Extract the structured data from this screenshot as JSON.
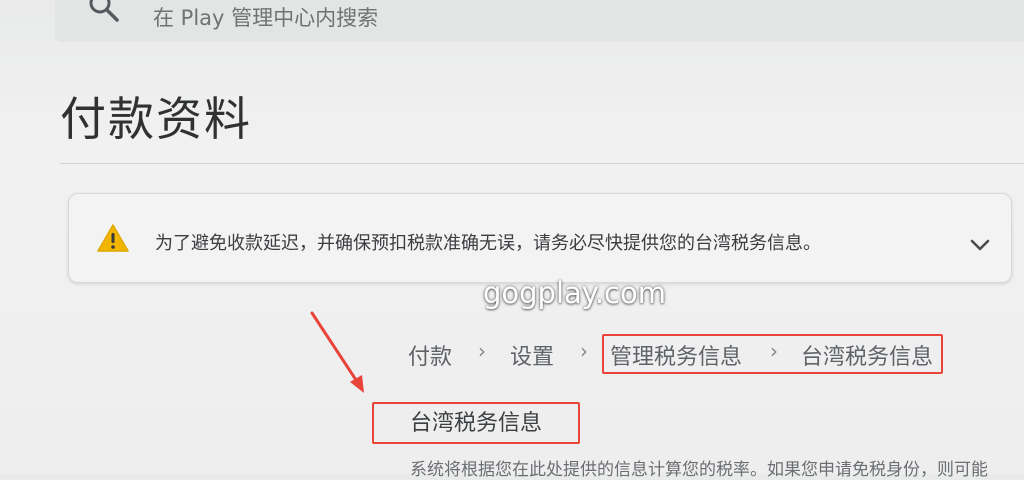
{
  "search": {
    "placeholder": "在 Play 管理中心内搜索"
  },
  "page": {
    "title": "付款资料"
  },
  "warning_banner": {
    "message": "为了避免收款延迟，并确保预扣税款准确无误，请务必尽快提供您的台湾税务信息。",
    "icon": "warning-triangle-icon"
  },
  "watermark": "gogplay.com",
  "breadcrumb": {
    "items": [
      "付款",
      "设置",
      "管理税务信息",
      "台湾税务信息"
    ],
    "separator": "›"
  },
  "section": {
    "heading": "台湾税务信息",
    "description": "系统将根据您在此处提供的信息计算您的税率。如果您申请免税身份，则可能"
  },
  "colors": {
    "annotation_red": "#e8443a",
    "warning_yellow": "#f2b600",
    "background": "#efefef"
  }
}
